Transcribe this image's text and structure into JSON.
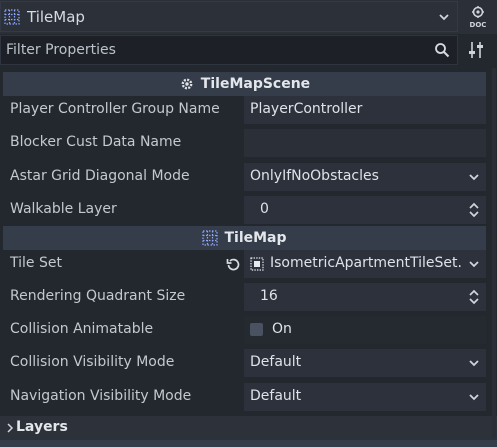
{
  "header": {
    "class_name": "TileMap",
    "icons": {
      "class": "tilemap-grid-icon",
      "dropdown": "chevron-down-icon",
      "doc": "doc-icon"
    }
  },
  "filter": {
    "placeholder": "Filter Properties",
    "value": "",
    "icons": {
      "search": "search-icon",
      "tools": "property-tools-icon"
    }
  },
  "sections": {
    "scene": {
      "title": "TileMapScene",
      "icon": "script-gear-icon"
    },
    "tilemap": {
      "title": "TileMap",
      "icon": "tilemap-grid-icon"
    }
  },
  "scene_props": [
    {
      "name": "Player Controller Group Name",
      "value": "PlayerController",
      "kind": "text"
    },
    {
      "name": "Blocker Cust Data Name",
      "value": "",
      "kind": "text"
    },
    {
      "name": "Astar Grid Diagonal Mode",
      "value": "OnlyIfNoObstacles",
      "kind": "enum"
    },
    {
      "name": "Walkable Layer",
      "value": "0",
      "kind": "number"
    }
  ],
  "tilemap_props": [
    {
      "name": "Tile Set",
      "value": "IsometricApartmentTileSet.",
      "kind": "resource"
    },
    {
      "name": "Rendering Quadrant Size",
      "value": "16",
      "kind": "number"
    },
    {
      "name": "Collision Animatable",
      "value": "On",
      "kind": "bool",
      "checked": false
    },
    {
      "name": "Collision Visibility Mode",
      "value": "Default",
      "kind": "enum"
    },
    {
      "name": "Navigation Visibility Mode",
      "value": "Default",
      "kind": "enum"
    }
  ],
  "layers_group": {
    "label": "Layers",
    "expanded": false
  },
  "colors": {
    "panel_bg": "#23272e",
    "section_header": "#363d4a",
    "field_bg": "#2c313b"
  }
}
